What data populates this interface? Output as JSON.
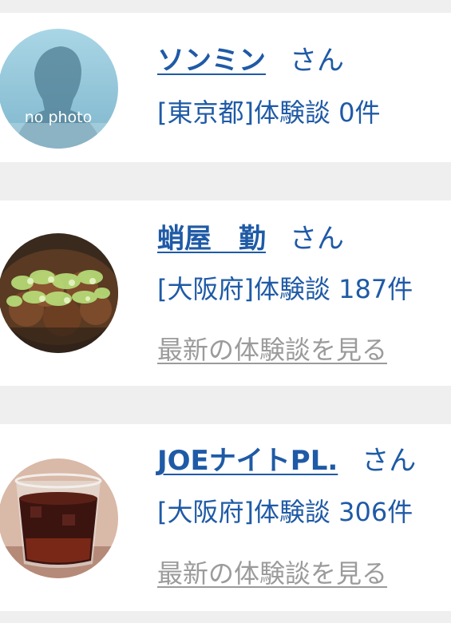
{
  "users": [
    {
      "name": "ソンミン",
      "honorific": "さん",
      "prefecture_text": "[東京都]体験談 0件",
      "avatar": "no-photo-placeholder",
      "avatar_text": "no photo"
    },
    {
      "name": "蛸屋　勤",
      "honorific": "さん",
      "prefecture_text": "[大阪府]体験談 187件",
      "latest_link": "最新の体験談を見る",
      "avatar": "takoyaki-photo"
    },
    {
      "name": "JOEナイトPL.",
      "honorific": "さん",
      "prefecture_text": "[大阪府]体験談 306件",
      "latest_link": "最新の体験談を見る",
      "avatar": "iced-drink-photo"
    }
  ],
  "colors": {
    "link": "#1f5aa6",
    "muted": "#9b9b9b",
    "background": "#efefef"
  }
}
